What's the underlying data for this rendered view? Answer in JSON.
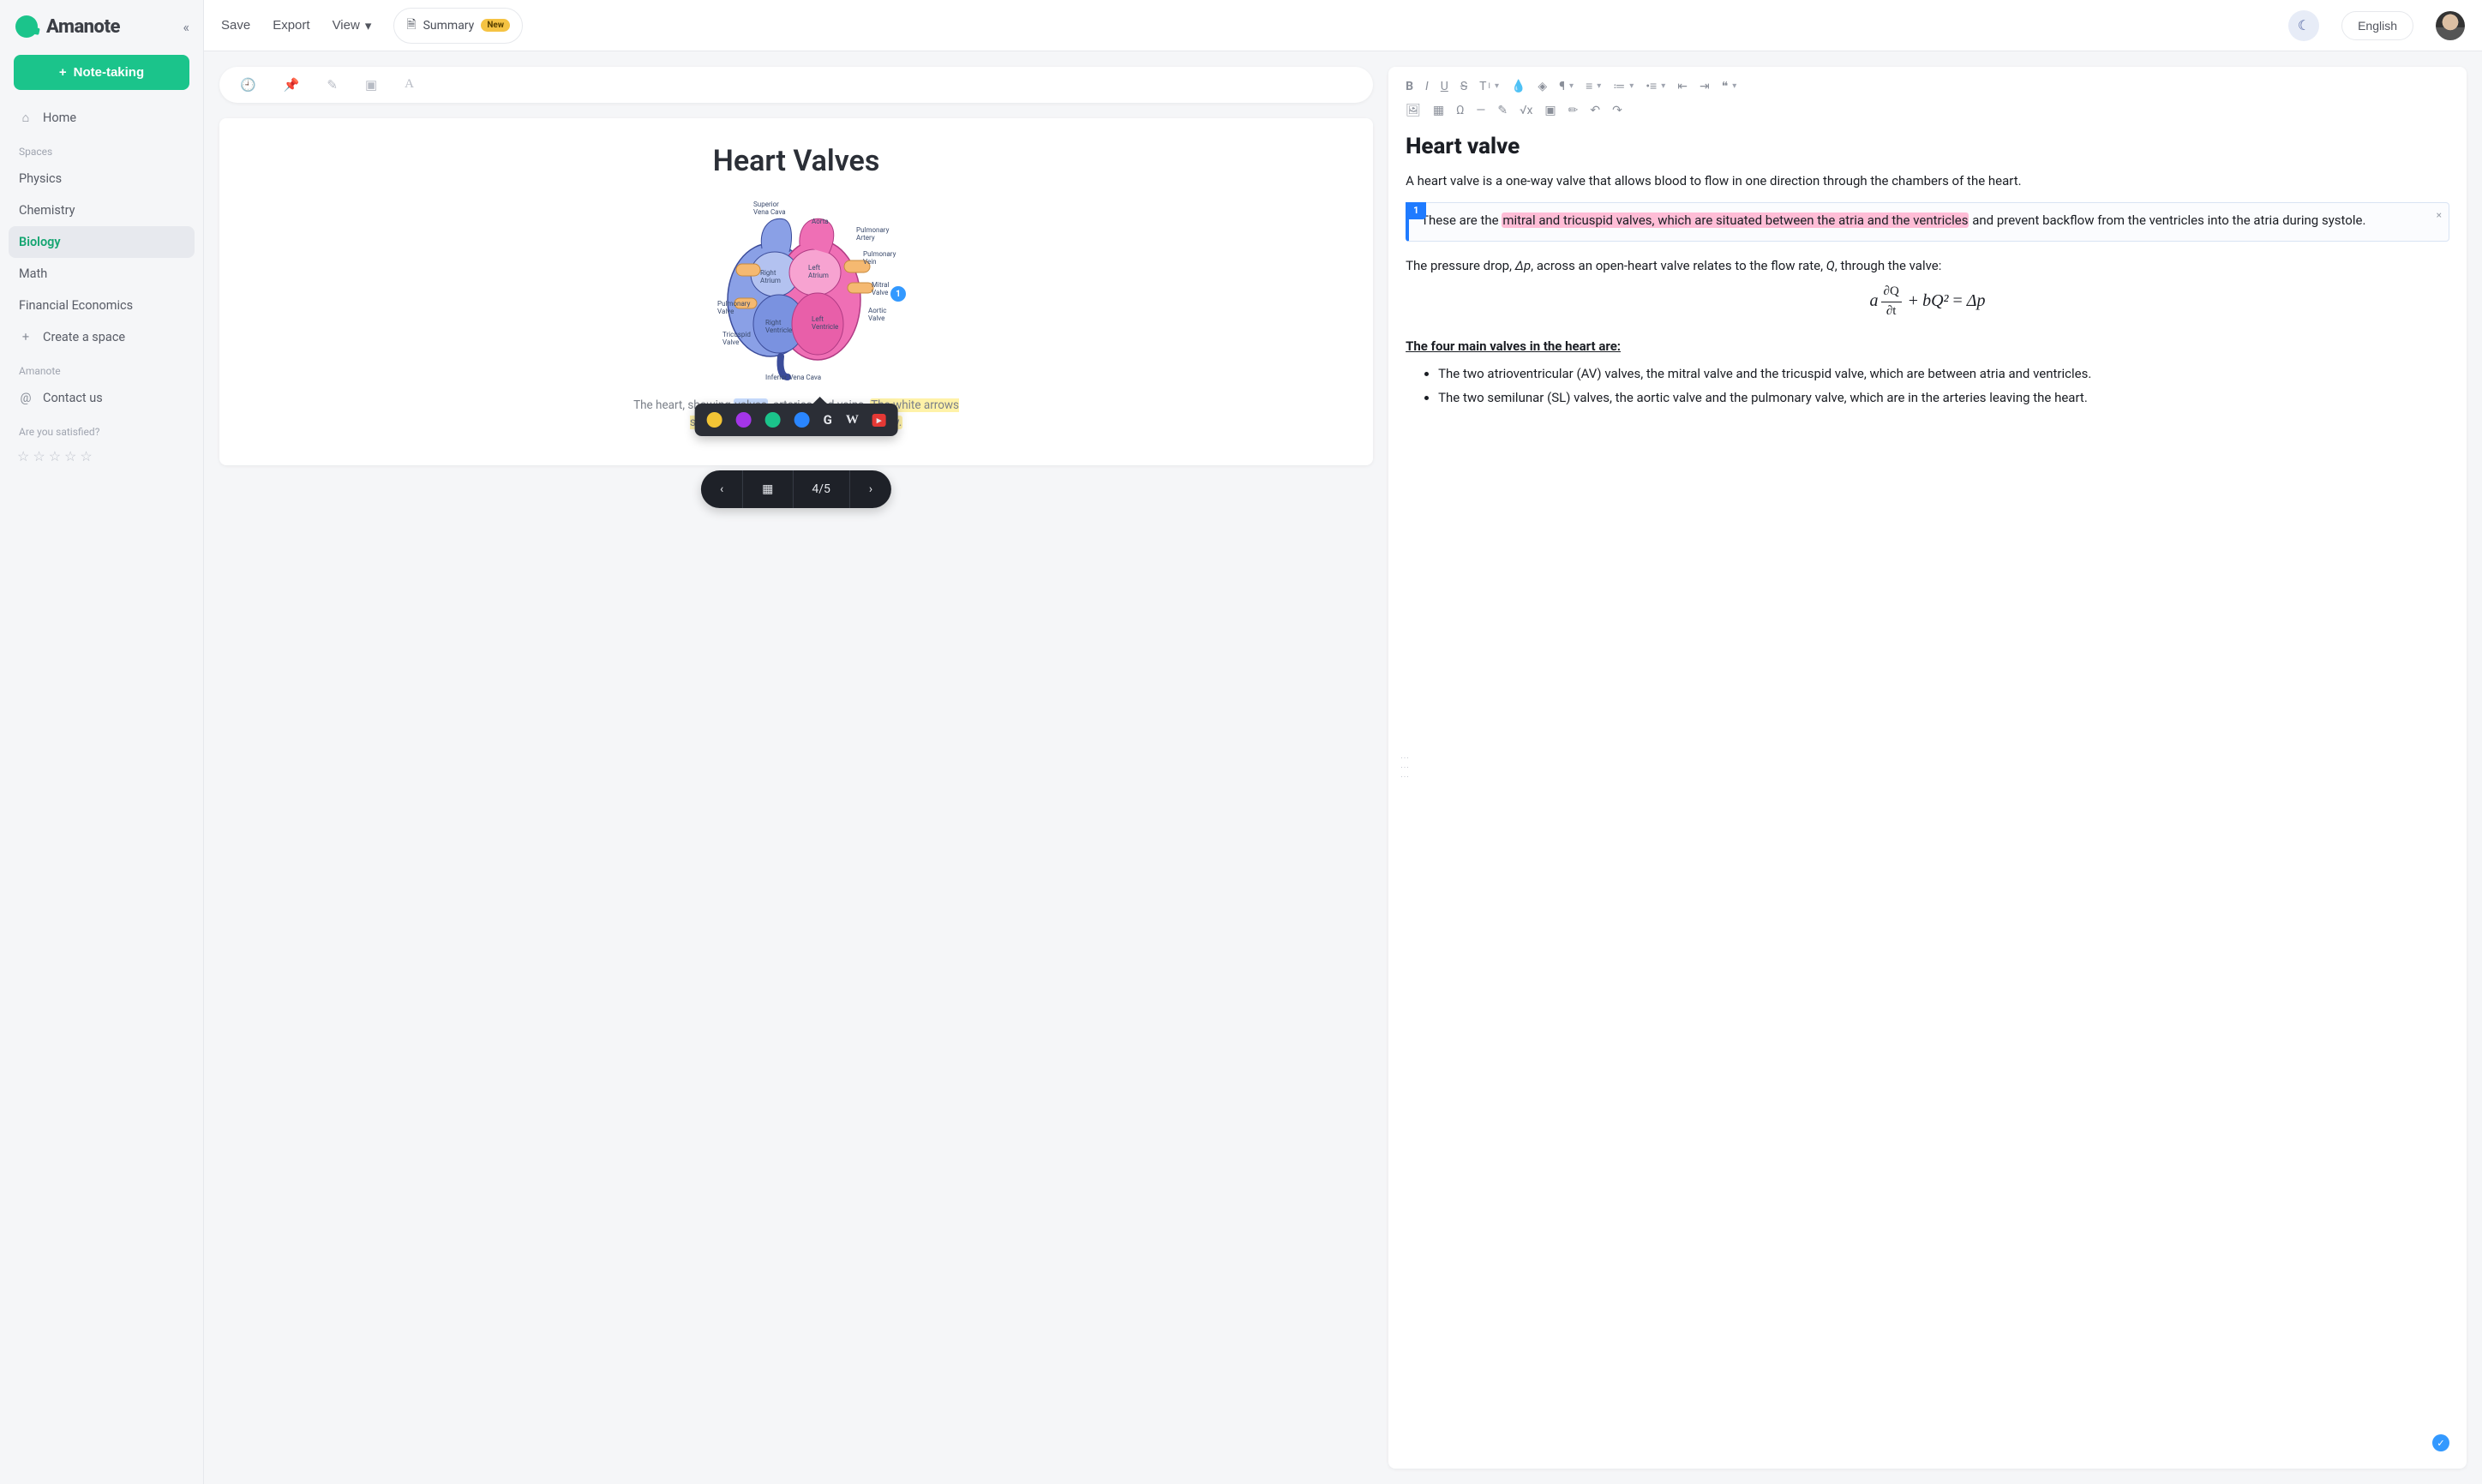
{
  "brand": {
    "name": "Amanote"
  },
  "sidebar": {
    "note_taking_label": "Note-taking",
    "home_label": "Home",
    "section_spaces": "Spaces",
    "spaces": [
      {
        "label": "Physics"
      },
      {
        "label": "Chemistry"
      },
      {
        "label": "Biology"
      },
      {
        "label": "Math"
      },
      {
        "label": "Financial Economics"
      }
    ],
    "create_space": "Create a space",
    "section_amanote": "Amanote",
    "contact_us": "Contact us",
    "satisfied_q": "Are you satisfied?"
  },
  "topbar": {
    "save": "Save",
    "export": "Export",
    "view": "View",
    "summary": "Summary",
    "new_badge": "New",
    "language": "English"
  },
  "document": {
    "title": "Heart Valves",
    "caption_pre": "The heart, showing ",
    "caption_hl1": "valves",
    "caption_mid": ", arteries and veins. ",
    "caption_hl2": "The white arrows shows the normal direction of blood flow.",
    "pin_label": "1",
    "labels": {
      "svc": "Superior\nVena Cava",
      "aorta": "Aorta",
      "pa": "Pulmonary\nArtery",
      "pv": "Pulmonary\nVein",
      "mv": "Mitral\nValve",
      "av": "Aortic\nValve",
      "ra": "Right\nAtrium",
      "la": "Left\nAtrium",
      "lv": "Left\nVentricle",
      "rv": "Right\nVentricle",
      "tv": "Tricuspid\nValve",
      "pvv": "Pulmonary\nValve",
      "ivc": "Inferior Vena Cava"
    },
    "pager": {
      "current": "4",
      "total": "5",
      "sep": " / "
    }
  },
  "popup": {
    "colors": [
      "#f2c435",
      "#a335e8",
      "#1bc48b",
      "#2a86ff"
    ],
    "google": "G",
    "wikipedia": "W",
    "youtube": "▸"
  },
  "editor": {
    "title": "Heart valve",
    "intro": "A heart valve is a one-way valve that allows blood to flow in one direction through the chambers of the heart.",
    "note_tag": "1",
    "note_pre": "These are the ",
    "note_hl": "mitral and tricuspid valves, which are situated between the atria and the ventricles",
    "note_post": " and prevent backflow from the ventricles into the atria during systole.",
    "pressure_pre": "The pressure drop, ",
    "pressure_dp": "Δp",
    "pressure_mid": ", across an open-heart valve relates to the flow rate, ",
    "pressure_q": "Q",
    "pressure_post": ", through the valve:",
    "eq_a": "a",
    "eq_frac_top": "∂Q",
    "eq_frac_bot": "∂t",
    "eq_plus": " + ",
    "eq_b": "b",
    "eq_q2": "Q²",
    "eq_eq": " = ",
    "eq_dp": "Δp",
    "sub_h": "The four main valves in the heart are:",
    "bullets": [
      "The two atrioventricular (AV) valves, the mitral valve and the tricuspid valve, which are between atria and ventricles.",
      "The two semilunar (SL) valves, the aortic valve and the pulmonary valve, which are in the arteries leaving the heart."
    ],
    "toolbar_font_size": "T"
  }
}
